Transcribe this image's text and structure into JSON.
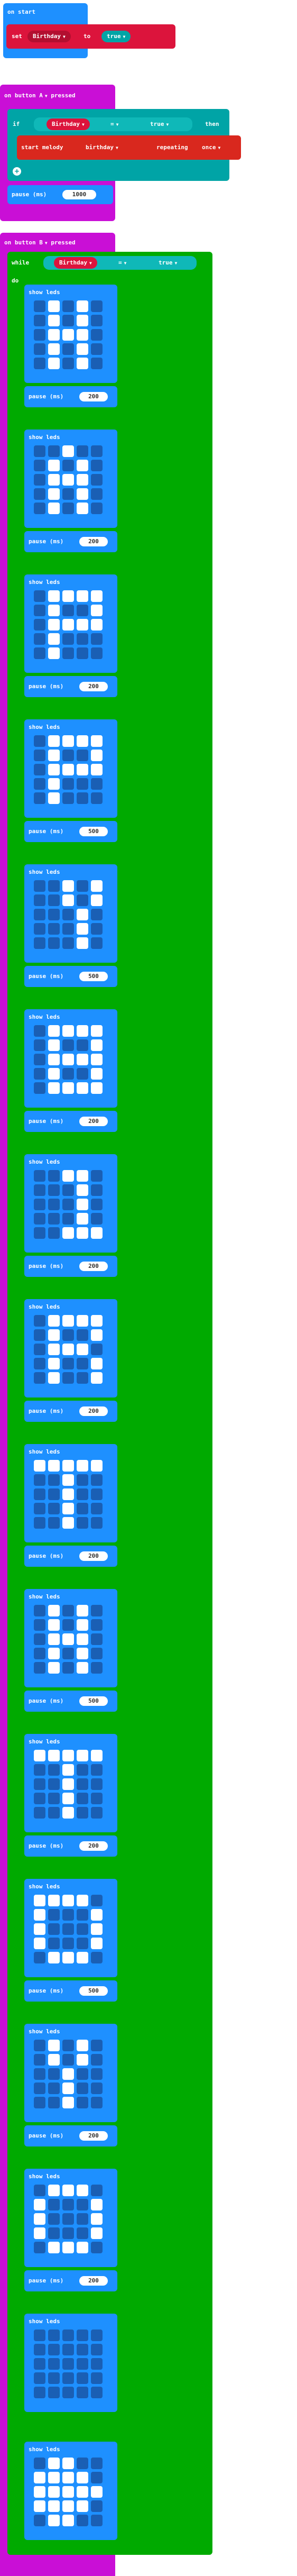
{
  "on_start": {
    "label": "on start",
    "set_label": "set",
    "var": "Birthday",
    "to_label": "to",
    "value": "true"
  },
  "button_a": {
    "label_prefix": "on button",
    "button": "A",
    "label_suffix": "pressed",
    "if_label": "if",
    "var": "Birthday",
    "op": "=",
    "value": "true",
    "then_label": "then",
    "melody_label": "start melody",
    "melody": "birthday",
    "repeat_label": "repeating",
    "repeat": "once",
    "pause_label": "pause (ms)",
    "pause": "1000"
  },
  "button_b": {
    "label_prefix": "on button",
    "button": "B",
    "label_suffix": "pressed",
    "while_label": "while",
    "var": "Birthday",
    "op": "=",
    "value": "true",
    "do_label": "do",
    "show_leds_label": "show leds",
    "pause_label": "pause (ms)",
    "frames": [
      {
        "leds": [
          [
            0,
            1,
            0,
            1,
            0
          ],
          [
            0,
            1,
            0,
            1,
            0
          ],
          [
            0,
            1,
            1,
            1,
            0
          ],
          [
            0,
            1,
            0,
            1,
            0
          ],
          [
            0,
            1,
            0,
            1,
            0
          ]
        ],
        "pause": "200"
      },
      {
        "leds": [
          [
            0,
            0,
            1,
            0,
            0
          ],
          [
            0,
            1,
            0,
            1,
            0
          ],
          [
            0,
            1,
            1,
            1,
            0
          ],
          [
            0,
            1,
            0,
            1,
            0
          ],
          [
            0,
            1,
            0,
            1,
            0
          ]
        ],
        "pause": "200"
      },
      {
        "leds": [
          [
            0,
            1,
            1,
            1,
            1
          ],
          [
            0,
            1,
            0,
            0,
            1
          ],
          [
            0,
            1,
            1,
            1,
            1
          ],
          [
            0,
            1,
            0,
            0,
            0
          ],
          [
            0,
            1,
            0,
            0,
            0
          ]
        ],
        "pause": "200"
      },
      {
        "leds": [
          [
            0,
            1,
            1,
            1,
            1
          ],
          [
            0,
            1,
            0,
            0,
            1
          ],
          [
            0,
            1,
            1,
            1,
            1
          ],
          [
            0,
            1,
            0,
            0,
            0
          ],
          [
            0,
            1,
            0,
            0,
            0
          ]
        ],
        "pause": "500"
      },
      {
        "leds": [
          [
            0,
            0,
            1,
            0,
            1
          ],
          [
            0,
            0,
            1,
            0,
            1
          ],
          [
            0,
            0,
            0,
            1,
            0
          ],
          [
            0,
            0,
            0,
            1,
            0
          ],
          [
            0,
            0,
            0,
            1,
            0
          ]
        ],
        "pause": "500"
      },
      {
        "leds": [
          [
            0,
            1,
            1,
            1,
            1
          ],
          [
            0,
            1,
            0,
            0,
            1
          ],
          [
            0,
            1,
            1,
            1,
            1
          ],
          [
            0,
            1,
            0,
            0,
            1
          ],
          [
            0,
            1,
            1,
            1,
            1
          ]
        ],
        "pause": "200"
      },
      {
        "leds": [
          [
            0,
            0,
            1,
            1,
            0
          ],
          [
            0,
            0,
            0,
            1,
            0
          ],
          [
            0,
            0,
            0,
            1,
            0
          ],
          [
            0,
            0,
            0,
            1,
            0
          ],
          [
            0,
            0,
            1,
            1,
            1
          ]
        ],
        "pause": "200"
      },
      {
        "leds": [
          [
            0,
            1,
            1,
            1,
            1
          ],
          [
            0,
            1,
            0,
            0,
            1
          ],
          [
            0,
            1,
            1,
            1,
            0
          ],
          [
            0,
            1,
            0,
            0,
            1
          ],
          [
            0,
            1,
            0,
            0,
            1
          ]
        ],
        "pause": "200"
      },
      {
        "leds": [
          [
            1,
            1,
            1,
            1,
            1
          ],
          [
            0,
            0,
            1,
            0,
            0
          ],
          [
            0,
            0,
            1,
            0,
            0
          ],
          [
            0,
            0,
            1,
            0,
            0
          ],
          [
            0,
            0,
            1,
            0,
            0
          ]
        ],
        "pause": "200"
      },
      {
        "leds": [
          [
            0,
            1,
            0,
            1,
            0
          ],
          [
            0,
            1,
            0,
            1,
            0
          ],
          [
            0,
            1,
            1,
            1,
            0
          ],
          [
            0,
            1,
            0,
            1,
            0
          ],
          [
            0,
            1,
            0,
            1,
            0
          ]
        ],
        "pause": "500"
      },
      {
        "leds": [
          [
            1,
            1,
            1,
            1,
            1
          ],
          [
            0,
            0,
            1,
            0,
            0
          ],
          [
            0,
            0,
            1,
            0,
            0
          ],
          [
            0,
            0,
            1,
            0,
            0
          ],
          [
            0,
            0,
            1,
            0,
            0
          ]
        ],
        "pause": "200"
      },
      {
        "leds": [
          [
            1,
            1,
            1,
            1,
            0
          ],
          [
            1,
            0,
            0,
            0,
            1
          ],
          [
            1,
            0,
            0,
            0,
            1
          ],
          [
            1,
            0,
            0,
            0,
            1
          ],
          [
            0,
            1,
            1,
            1,
            0
          ]
        ],
        "pause": "500"
      },
      {
        "leds": [
          [
            0,
            1,
            0,
            1,
            0
          ],
          [
            0,
            1,
            0,
            1,
            0
          ],
          [
            0,
            0,
            1,
            0,
            0
          ],
          [
            0,
            0,
            1,
            0,
            0
          ],
          [
            0,
            0,
            1,
            0,
            0
          ]
        ],
        "pause": "200"
      },
      {
        "leds": [
          [
            0,
            1,
            1,
            1,
            0
          ],
          [
            1,
            0,
            0,
            0,
            1
          ],
          [
            1,
            0,
            0,
            0,
            1
          ],
          [
            1,
            0,
            0,
            0,
            1
          ],
          [
            0,
            1,
            1,
            1,
            0
          ]
        ],
        "pause": "200"
      },
      {
        "leds": [
          [
            0,
            0,
            0,
            0,
            0
          ],
          [
            0,
            0,
            0,
            0,
            0
          ],
          [
            0,
            0,
            0,
            0,
            0
          ],
          [
            0,
            0,
            0,
            0,
            0
          ],
          [
            0,
            0,
            0,
            0,
            0
          ]
        ],
        "pause": null
      },
      {
        "leds": [
          [
            0,
            1,
            1,
            0,
            0
          ],
          [
            1,
            1,
            1,
            1,
            0
          ],
          [
            1,
            1,
            1,
            1,
            1
          ],
          [
            1,
            1,
            1,
            1,
            0
          ],
          [
            0,
            1,
            1,
            0,
            0
          ]
        ],
        "pause": null
      }
    ]
  },
  "colors": {
    "events": "#1e90ff",
    "variables": "#dc143c",
    "logic": "#00a4a6",
    "loops": "#00aa00",
    "music": "#d9281e",
    "input": "#c90fd6",
    "basic": "#1e90ff"
  }
}
